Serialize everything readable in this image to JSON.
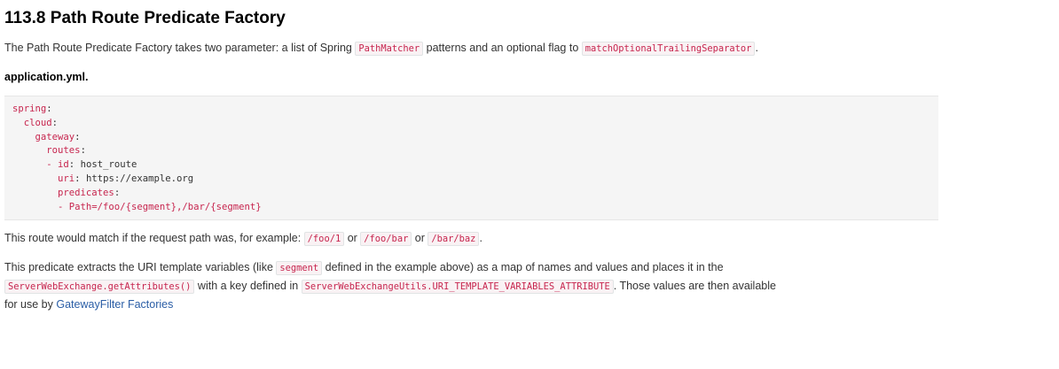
{
  "title": "113.8 Path Route Predicate Factory",
  "intro": {
    "t1": "The Path Route Predicate Factory takes two parameter: a list of Spring ",
    "c1": "PathMatcher",
    "t2": " patterns and an optional flag to ",
    "c2": "matchOptionalTrailingSeparator",
    "t3": "."
  },
  "caption": "application.yml.",
  "code": {
    "l1k": "spring",
    "l2k": "cloud",
    "l3k": "gateway",
    "l4k": "routes",
    "l5k": "- id",
    "l5v": "host_route",
    "l6k": "uri",
    "l6v": "https://example.org",
    "l7k": "predicates",
    "l8k": "- Path=/foo/{segment},/bar/{segment}"
  },
  "match": {
    "t1": "This route would match if the request path was, for example: ",
    "c1": "/foo/1",
    "t2": " or ",
    "c2": "/foo/bar",
    "t3": " or ",
    "c3": "/bar/baz",
    "t4": "."
  },
  "desc": {
    "t1": "This predicate extracts the URI template variables (like ",
    "c1": "segment",
    "t2": " defined in the example above) as a map of names and values and places it in the",
    "c2": "ServerWebExchange.getAttributes()",
    "t3": " with a key defined in ",
    "c3": "ServerWebExchangeUtils.URI_TEMPLATE_VARIABLES_ATTRIBUTE",
    "t4": ". Those values are then available",
    "t5": "for use by ",
    "link": "GatewayFilter Factories"
  }
}
